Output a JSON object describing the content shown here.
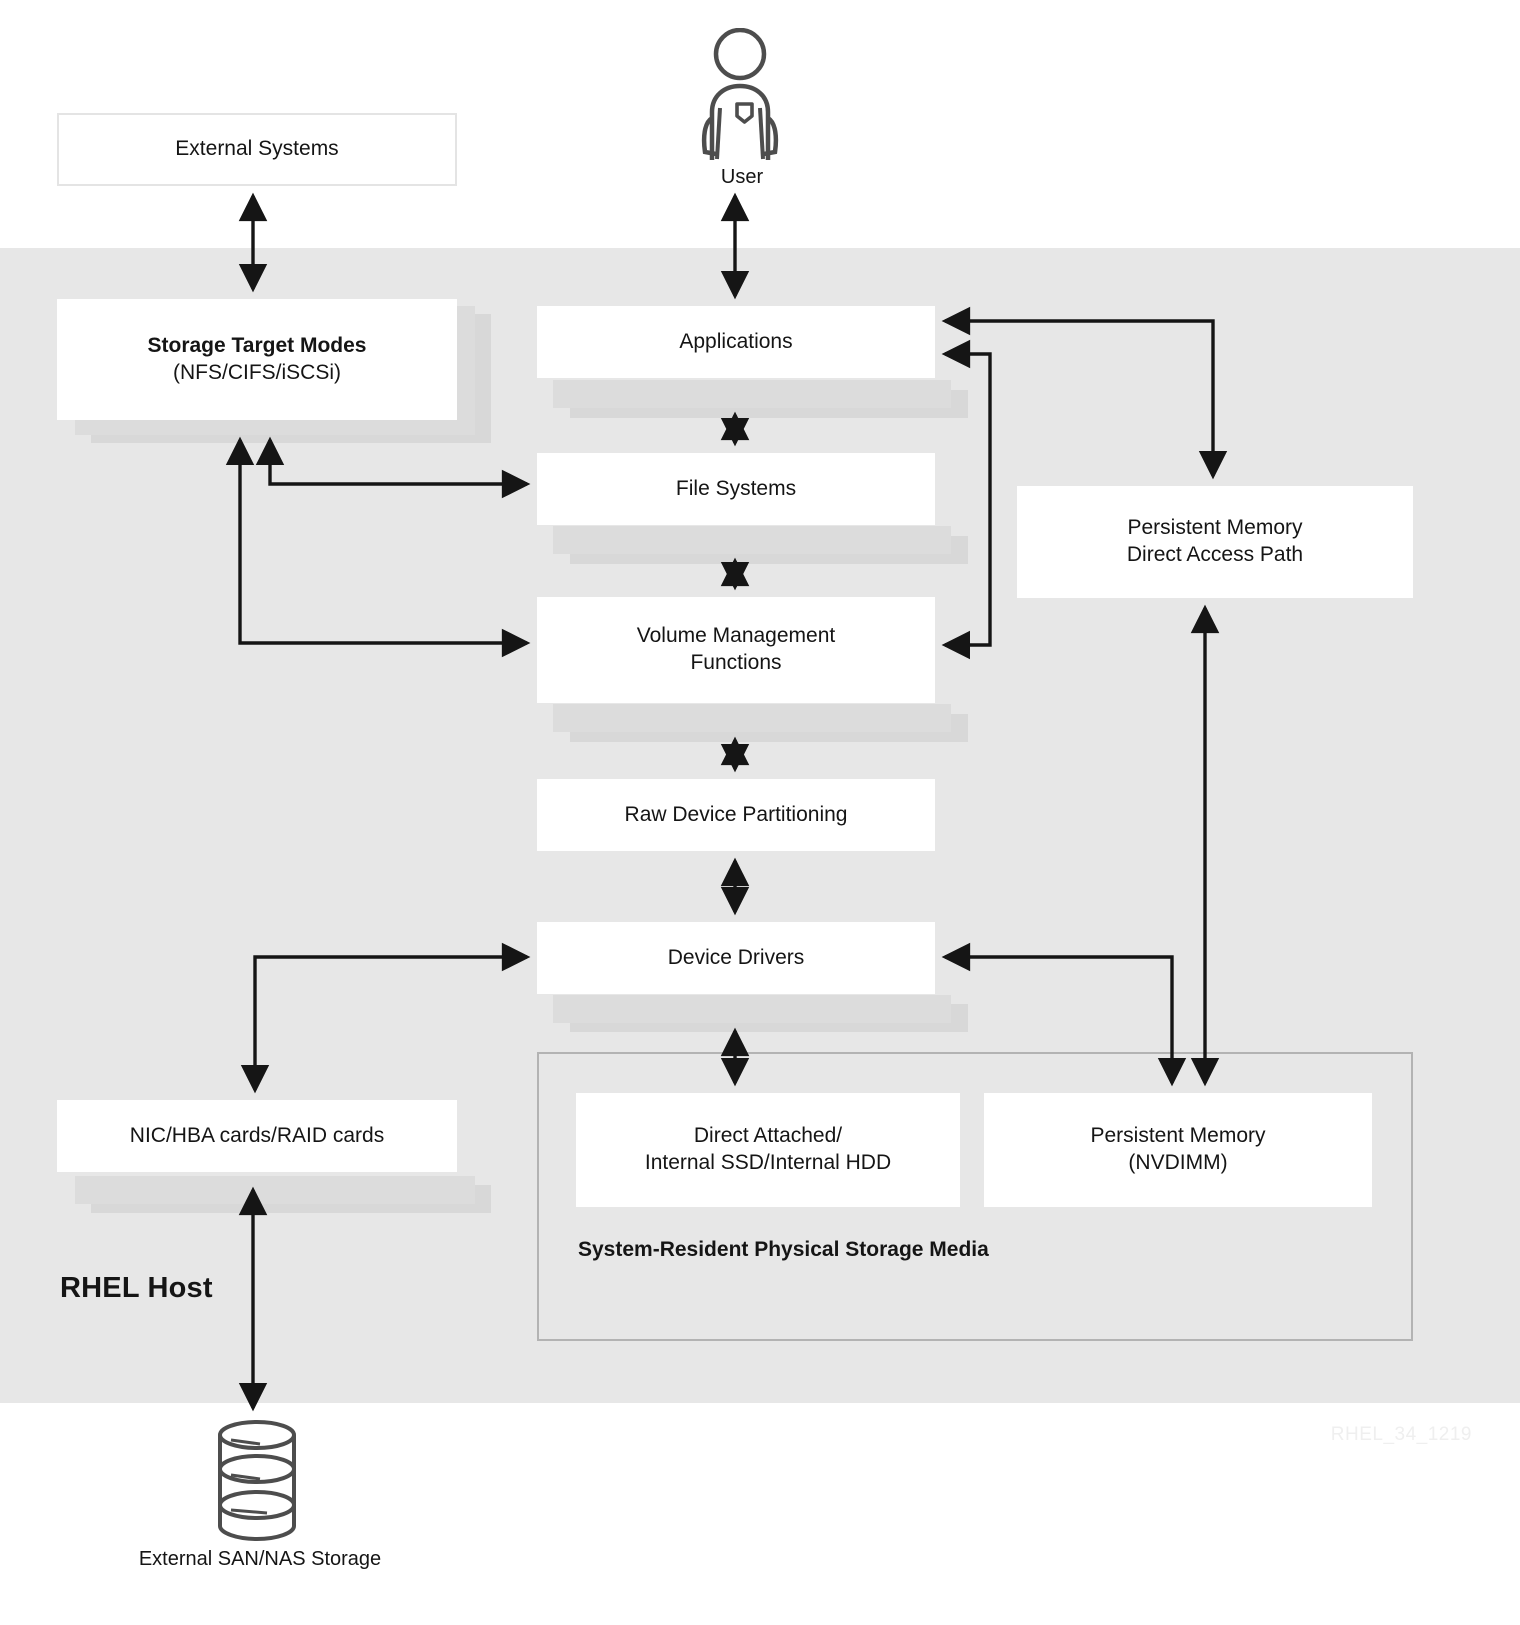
{
  "diagram": {
    "watermark": "RHEL_34_1219",
    "host_region_label": "RHEL Host",
    "group_caption": "System-Resident Physical Storage Media",
    "user_icon_caption": "User",
    "storage_icon_caption": "External SAN/NAS Storage"
  },
  "nodes": {
    "external_systems": {
      "title": "External Systems",
      "subtitle": ""
    },
    "storage_target_modes": {
      "title": "Storage Target Modes",
      "subtitle": "(NFS/CIFS/iSCSi)"
    },
    "applications": {
      "title": "Applications",
      "subtitle": ""
    },
    "file_systems": {
      "title": "File Systems",
      "subtitle": ""
    },
    "volume_management": {
      "title": "Volume Management",
      "subtitle": "Functions"
    },
    "raw_device_partitioning": {
      "title": "Raw Device Partitioning",
      "subtitle": ""
    },
    "device_drivers": {
      "title": "Device Drivers",
      "subtitle": ""
    },
    "nic_hba_raid": {
      "title": "NIC/HBA cards/RAID cards",
      "subtitle": ""
    },
    "pmem_direct_access": {
      "title": "Persistent Memory",
      "subtitle": "Direct Access Path"
    },
    "direct_attached": {
      "title": "Direct Attached/",
      "subtitle": "Internal SSD/Internal HDD"
    },
    "persistent_memory": {
      "title": "Persistent Memory",
      "subtitle": "(NVDIMM)"
    }
  },
  "colors": {
    "host_band": "#e7e7e7",
    "node_fill": "#ffffff",
    "stack_shadow": "#dcdcdc",
    "group_border": "#b3b3b3",
    "arrow": "#151515",
    "icon_stroke": "#4d4d4d",
    "watermark": "#efefef"
  }
}
